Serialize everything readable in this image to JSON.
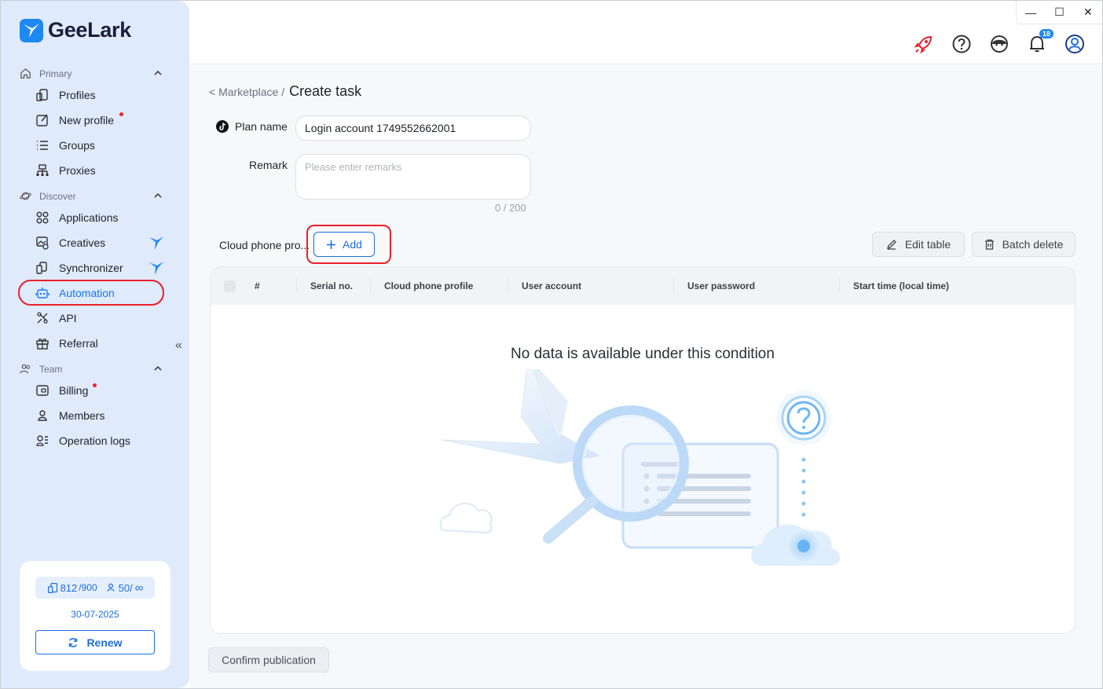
{
  "app": {
    "brand": "GeeLark"
  },
  "sidebar": {
    "sections": [
      {
        "label": "Primary"
      },
      {
        "label": "Discover"
      },
      {
        "label": "Team"
      }
    ],
    "items": [
      {
        "label": "Profiles"
      },
      {
        "label": "New profile"
      },
      {
        "label": "Groups"
      },
      {
        "label": "Proxies"
      },
      {
        "label": "Applications"
      },
      {
        "label": "Creatives"
      },
      {
        "label": "Synchronizer"
      },
      {
        "label": "Automation"
      },
      {
        "label": "API"
      },
      {
        "label": "Referral"
      },
      {
        "label": "Billing"
      },
      {
        "label": "Members"
      },
      {
        "label": "Operation logs"
      }
    ],
    "account": {
      "profiles_used": "812",
      "profiles_total": "/900",
      "members_used": "50/",
      "members_total": "∞",
      "expiry": "30-07-2025",
      "renew_label": "Renew"
    }
  },
  "topbar": {
    "notification_count": "18",
    "icons": [
      "rocket-icon",
      "help-icon",
      "support-icon",
      "bell-icon",
      "user-icon"
    ]
  },
  "breadcrumb": {
    "back": "< Marketplace /",
    "current": "Create task"
  },
  "form": {
    "plan_name_label": "Plan name",
    "plan_name_value": "Login account 1749552662001",
    "remark_label": "Remark",
    "remark_placeholder": "Please enter remarks",
    "remark_counter": "0 / 200",
    "cloud_phone_label": "Cloud phone pro...",
    "add_label": "Add",
    "edit_table_label": "Edit table",
    "batch_delete_label": "Batch delete"
  },
  "table": {
    "columns": [
      "#",
      "Serial no.",
      "Cloud phone profile",
      "User account",
      "User password",
      "Start time (local time)"
    ],
    "empty_text": "No data is available under this condition"
  },
  "footer": {
    "confirm_label": "Confirm publication"
  },
  "colors": {
    "accent": "#1e6fe0",
    "sidebar_bg": "#dfeafb",
    "highlight_ring": "#e8202b"
  }
}
